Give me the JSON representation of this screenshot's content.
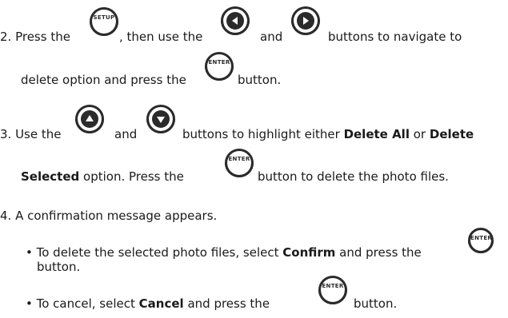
{
  "step2": {
    "line1": {
      "a": "2. Press the",
      "b": ", then use the",
      "c": "and",
      "d": "buttons to navigate to"
    },
    "line2": {
      "a": "delete option and press the",
      "b": "button."
    },
    "setup_label": "SETUP",
    "enter_label": "ENTER"
  },
  "step3": {
    "line1": {
      "a": "3. Use the",
      "b": "and",
      "c": "buttons to highlight either",
      "d": "Delete All",
      "e": "or",
      "f": "Delete"
    },
    "line2": {
      "a": "Selected",
      "b": "option. Press the",
      "c": "button to delete the photo files."
    },
    "enter_label": "ENTER"
  },
  "step4": {
    "text": "4. A confirmation message appears.",
    "bullet1": {
      "a": "• To delete the selected photo files, select",
      "b": "Confirm",
      "c": "and press the",
      "d": "button.",
      "enter_label": "ENTER"
    },
    "bullet2": {
      "a": "• To cancel, select",
      "b": "Cancel",
      "c": "and press the",
      "d": "button.",
      "enter_label": "ENTER"
    }
  },
  "icons": {
    "setup": "setup-button-icon",
    "left": "left-arrow-button-icon",
    "right": "right-arrow-button-icon",
    "up": "up-arrow-button-icon",
    "down": "down-arrow-button-icon",
    "enter": "enter-button-icon"
  }
}
